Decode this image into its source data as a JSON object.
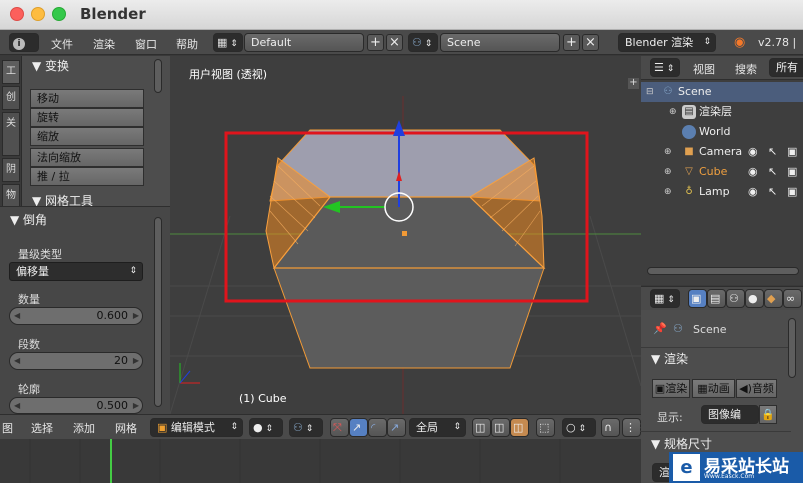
{
  "window": {
    "title": "Blender"
  },
  "info_header": {
    "menus": [
      "文件",
      "渲染",
      "窗口",
      "帮助"
    ],
    "screen_layout": "Default",
    "scene": "Scene",
    "render_engine": "Blender 渲染",
    "version": "v2.78 |"
  },
  "tool_shelf": {
    "tabs": [
      "工",
      "创",
      "关",
      "阴",
      "物"
    ],
    "transform_panel": {
      "title": "▼ 变换",
      "buttons": [
        "移动",
        "旋转",
        "缩放",
        "法向缩放",
        "推 / 拉"
      ]
    },
    "mesh_tools_title": "▼ 网格工具",
    "bevel_panel": {
      "title": "▼ 倒角",
      "amount_type_label": "量级类型",
      "amount_type_value": "偏移量",
      "amount_label": "数量",
      "amount_value": "0.600",
      "segments_label": "段数",
      "segments_value": "20",
      "profile_label": "轮廓",
      "profile_value": "0.500"
    }
  },
  "viewport": {
    "view_label": "用户视图 (透视)",
    "object_label": "(1) Cube"
  },
  "view3d_header": {
    "menus": [
      "图",
      "选择",
      "添加",
      "网格"
    ],
    "mode": "编辑模式",
    "pivot": "全局"
  },
  "outliner": {
    "header": {
      "view": "视图",
      "search": "搜索",
      "filter": "所有"
    },
    "rows": [
      {
        "label": "Scene",
        "icon": "scene-icon"
      },
      {
        "label": "渲染层",
        "icon": "render-layers-icon"
      },
      {
        "label": "World",
        "icon": "world-icon"
      },
      {
        "label": "Camera",
        "icon": "camera-icon"
      },
      {
        "label": "Cube",
        "icon": "mesh-icon"
      },
      {
        "label": "Lamp",
        "icon": "lamp-icon"
      }
    ]
  },
  "properties": {
    "breadcrumb": "Scene",
    "render_panel_title": "▼ 渲染",
    "render_button": "渲染",
    "animation_button": "动画",
    "audio_button": "音频",
    "display_label": "显示:",
    "display_value": "图像编",
    "dimensions_title": "▼ 规格尺寸",
    "preset_partial": "渲"
  },
  "watermark": {
    "text": "易采站长站",
    "sub": "Www.Easck.Com"
  },
  "colors": {
    "accent_select": "#4b5d7c",
    "bevel_orange": "#f7922c",
    "highlight_red": "#e0141c",
    "manipulator_blue": "#1f3fe0",
    "manipulator_green": "#22c422",
    "manipulator_red": "#e02020"
  }
}
